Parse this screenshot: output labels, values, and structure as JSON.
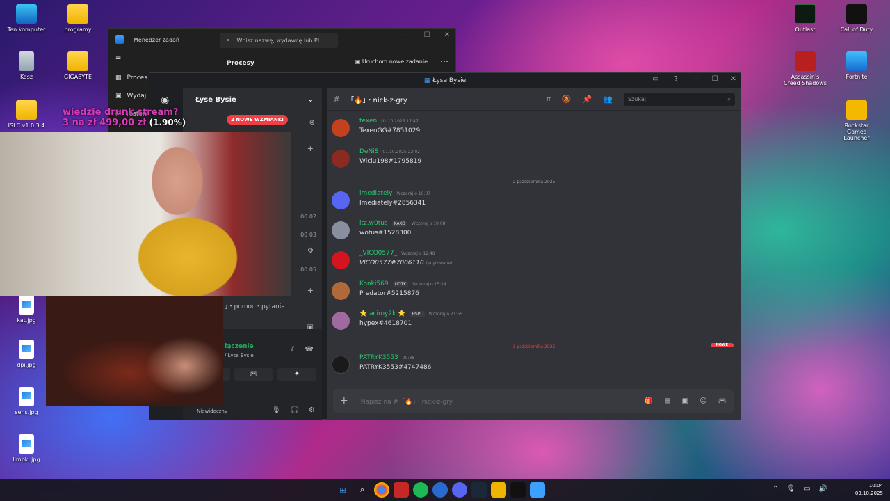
{
  "desktop": {
    "icons_left": [
      {
        "label": "Ten komputer"
      },
      {
        "label": "programy"
      },
      {
        "label": "Kosz"
      },
      {
        "label": "GIGABYTE"
      },
      {
        "label": "ISLC v1.0.3.4"
      },
      {
        "label": "kat.jpg"
      },
      {
        "label": "dpi.jpg"
      },
      {
        "label": "sens.jpg"
      },
      {
        "label": "limpki.jpg"
      }
    ],
    "icons_right": [
      {
        "label": "Outlast"
      },
      {
        "label": "Call of Duty"
      },
      {
        "label": "Assassin's Creed Shadows"
      },
      {
        "label": "Fortnite"
      },
      {
        "label": "Rockstar Games Launcher"
      }
    ]
  },
  "task_manager": {
    "title": "Menedżer zadań",
    "search_placeholder": "Wpisz nazwę, wydawcę lub PI...",
    "nav": [
      "Proces",
      "Wydaj",
      "Histori"
    ],
    "section": "Procesy",
    "new_task": "Uruchom nowe zadanie"
  },
  "overlay": {
    "line1": "wiedzie drunk stream?",
    "line2": "3 na zł 499,00 zł",
    "pct": "(1.90%)",
    "mentions": "2 NOWE WZMIANKI"
  },
  "discord": {
    "window_title": "Łyse Bysie",
    "server_name": "Łyse Bysie",
    "channel_name": "「🔥」・nick-z-gry",
    "search_placeholder": "Szukaj",
    "composer_placeholder": "Napisz na #「🔥」・nick-z-gry",
    "channel_visible": "」・pomoc・pytania",
    "voice": {
      "status": "łączenie",
      "server": "/ Łyse Bysie",
      "user_status": "Niewidoczny"
    },
    "channel_counts": [
      "00 02",
      "00 03",
      "00 05"
    ],
    "messages": [
      {
        "name": "texen",
        "time": "01.10.2025 17:47",
        "text": "TexenGG#7851029",
        "name_color": "#2dc770",
        "avatar": "#c4411e"
      },
      {
        "name": "DeNiS",
        "time": "01.10.2025 22:02",
        "text": "Wiciu198#1795819",
        "name_color": "#2dc770",
        "avatar": "#8a2a20"
      },
      {
        "name": "imediately",
        "time": "Wczoraj o 10:07",
        "text": "Imediately#2856341",
        "name_color": "#2dc770",
        "avatar": "#5865f2"
      },
      {
        "name": "itz.w0tus",
        "badge": "KAKO",
        "time": "Wczoraj o 10:08",
        "text": "wotus#1528300",
        "name_color": "#2dc770",
        "avatar": "#8a8fa0"
      },
      {
        "name": "_VICO0577_",
        "time": "Wczoraj o 12:48",
        "text": "VICO0577#7006110",
        "edited": "(edytowane)",
        "name_color": "#2dc770",
        "avatar": "#d4141e"
      },
      {
        "name": "Konki569",
        "badge": "UDTK",
        "time": "Wczoraj o 15:14",
        "text": "Predator#5215876",
        "name_color": "#2dc770",
        "avatar": "#b06a3a"
      },
      {
        "name": "⭐ aciroy2k ⭐",
        "badge": "HSPL",
        "time": "Wczoraj o 21:55",
        "text": "hypex#4618701",
        "name_color": "#2dc770",
        "avatar": "#a06aa0"
      },
      {
        "name": "PATRYK3553",
        "time": "09:38",
        "text": "PATRYK3553#4747486",
        "name_color": "#2dc770",
        "avatar": "#1a1a1a"
      }
    ],
    "dividers": {
      "d1": "2 października 2025",
      "d2": "3 października 2025",
      "new": "NOWE"
    }
  },
  "taskbar": {
    "time": "10:04",
    "date": "03.10.2025"
  }
}
